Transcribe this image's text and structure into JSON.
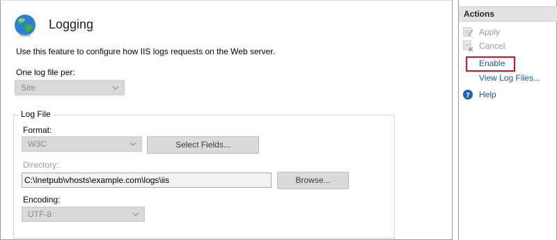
{
  "main": {
    "title": "Logging",
    "description": "Use this feature to configure how IIS logs requests on the Web server.",
    "one_log_label": "One log file per:",
    "one_log_value": "Site",
    "log_file_group": "Log File",
    "format_label": "Format:",
    "format_value": "W3C",
    "select_fields_label": "Select Fields...",
    "directory_label": "Directory:",
    "directory_value": "C:\\Inetpub\\vhosts\\example.com\\logs\\iis",
    "browse_label": "Browse...",
    "encoding_label": "Encoding:",
    "encoding_value": "UTF-8"
  },
  "actions": {
    "header": "Actions",
    "items": [
      {
        "label": "Apply",
        "icon": "apply-icon",
        "enabled": false
      },
      {
        "label": "Cancel",
        "icon": "cancel-icon",
        "enabled": false
      },
      {
        "label": "Enable",
        "icon": "",
        "enabled": true,
        "highlighted": true
      },
      {
        "label": "View Log Files...",
        "icon": "",
        "enabled": true
      },
      {
        "label": "Help",
        "icon": "help-icon",
        "enabled": true
      }
    ]
  },
  "colors": {
    "link": "#1a57b0",
    "highlight": "#e0101a",
    "disabled_text": "#9a9a9a"
  }
}
